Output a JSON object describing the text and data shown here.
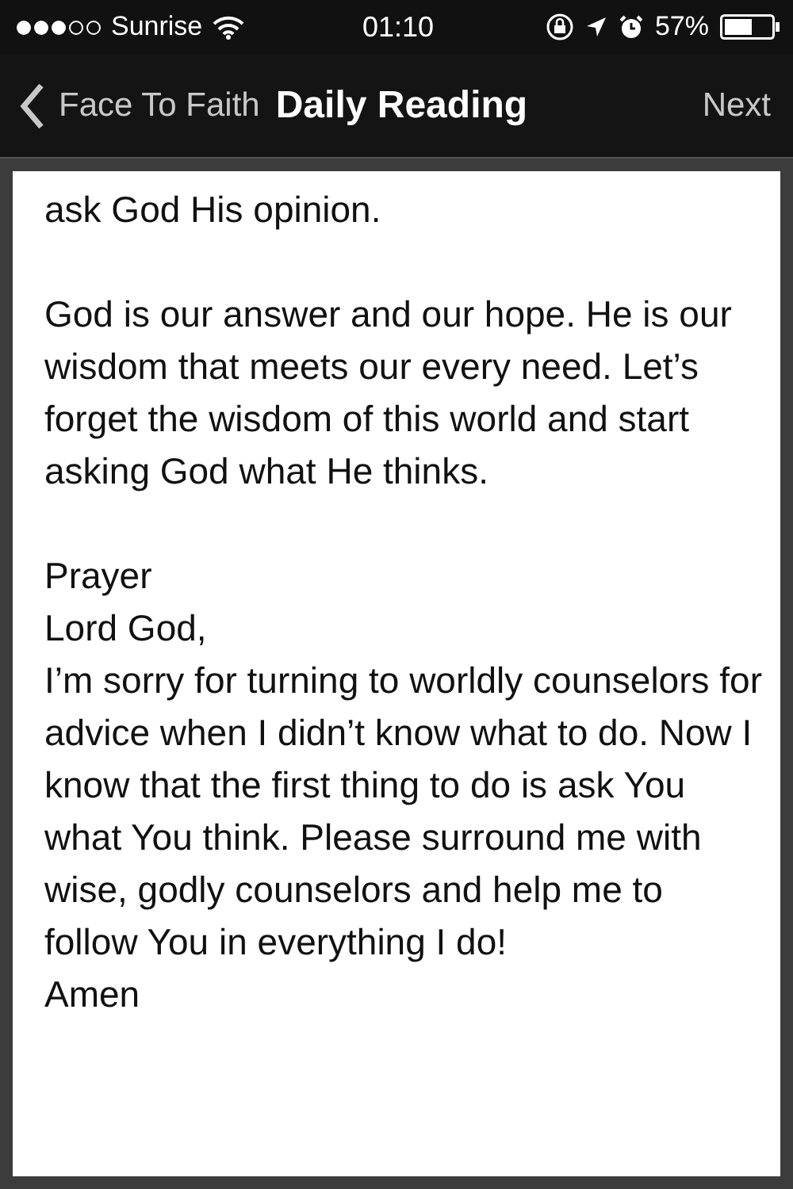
{
  "status_bar": {
    "carrier": "Sunrise",
    "time": "01:10",
    "battery": "57%"
  },
  "nav": {
    "back": "Face To Faith",
    "title": "Daily Reading",
    "next": "Next"
  },
  "content": [
    {
      "kind": "para",
      "text": "ask God His opinion."
    },
    {
      "kind": "para",
      "text": "God is our answer and our hope. He is our wisdom that meets our every need. Let’s forget the wisdom of this world and start asking God what He thinks."
    },
    {
      "kind": "line",
      "text": "Prayer"
    },
    {
      "kind": "line",
      "text": "Lord God,"
    },
    {
      "kind": "line",
      "text": "I’m sorry for turning to worldly counselors for advice when I didn’t know what to do. Now I know that the first thing to do is ask You what You think. Please surround me with wise, godly counselors and help me to follow You in everything I do!"
    },
    {
      "kind": "line",
      "text": "Amen"
    }
  ]
}
